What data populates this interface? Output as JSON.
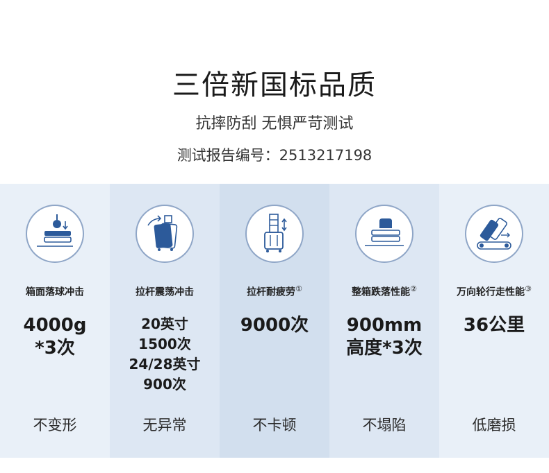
{
  "header": {
    "title": "三倍新国标品质",
    "subtitle": "抗摔防刮 无惧严苛测试",
    "report": "测试报告编号：2513217198"
  },
  "colors": {
    "col_bg": [
      "#e9f0f8",
      "#dde7f3",
      "#d2dfee",
      "#dde7f3",
      "#e9f0f8"
    ],
    "icon_stroke": "#2c5a9a",
    "badge_border": "#8fa6c7"
  },
  "tests": [
    {
      "icon": "drop-impact-icon",
      "name": "箱面落球冲击",
      "note": "",
      "value_lines": [
        "4000g",
        "*3次"
      ],
      "result": "不变形"
    },
    {
      "icon": "handle-shake-icon",
      "name": "拉杆震荡冲击",
      "note": "",
      "value_lines": [
        "20英寸",
        "1500次",
        "24/28英寸",
        "900次"
      ],
      "result": "无异常"
    },
    {
      "icon": "handle-fatigue-icon",
      "name": "拉杆耐疲劳",
      "note": "①",
      "value_lines": [
        "9000次"
      ],
      "result": "不卡顿"
    },
    {
      "icon": "box-drop-icon",
      "name": "整箱跌落性能",
      "note": "②",
      "value_lines": [
        "900mm",
        "高度*3次"
      ],
      "result": "不塌陷"
    },
    {
      "icon": "wheel-travel-icon",
      "name": "万向轮行走性能",
      "note": "③",
      "value_lines": [
        "36公里"
      ],
      "result": "低磨损"
    }
  ]
}
